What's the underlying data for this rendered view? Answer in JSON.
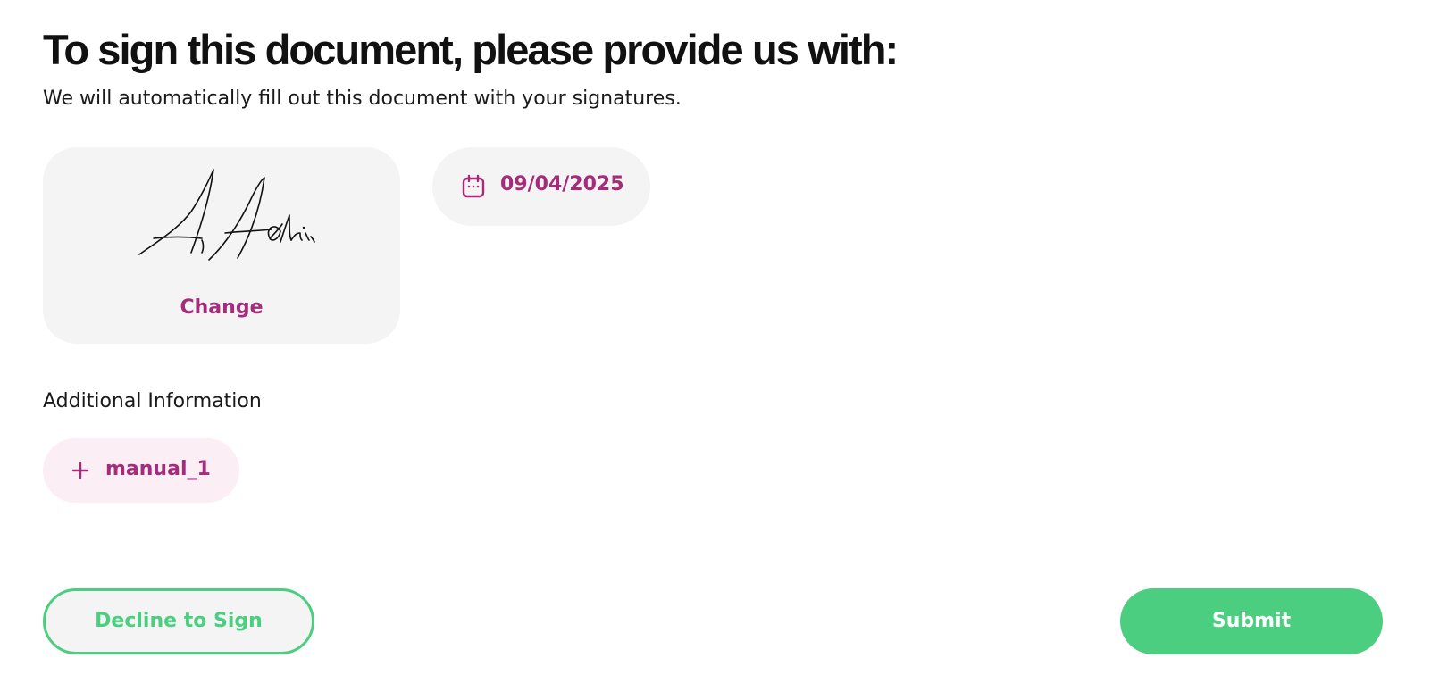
{
  "header": {
    "title": "To sign this document, please provide us with:",
    "subtitle": "We will automatically fill out this document with your signatures."
  },
  "signature": {
    "change_label": "Change",
    "signed_name": "A. Adni"
  },
  "date": {
    "value": "09/04/2025",
    "icon": "calendar-icon"
  },
  "additional_info": {
    "label": "Additional Information",
    "fields": [
      {
        "label": "manual_1",
        "icon": "plus-icon"
      }
    ]
  },
  "actions": {
    "decline_label": "Decline to Sign",
    "submit_label": "Submit"
  },
  "colors": {
    "accent": "#a52c7b",
    "success": "#4cce81",
    "card_bg": "#f4f4f4",
    "chip_bg": "#fbeef5"
  }
}
